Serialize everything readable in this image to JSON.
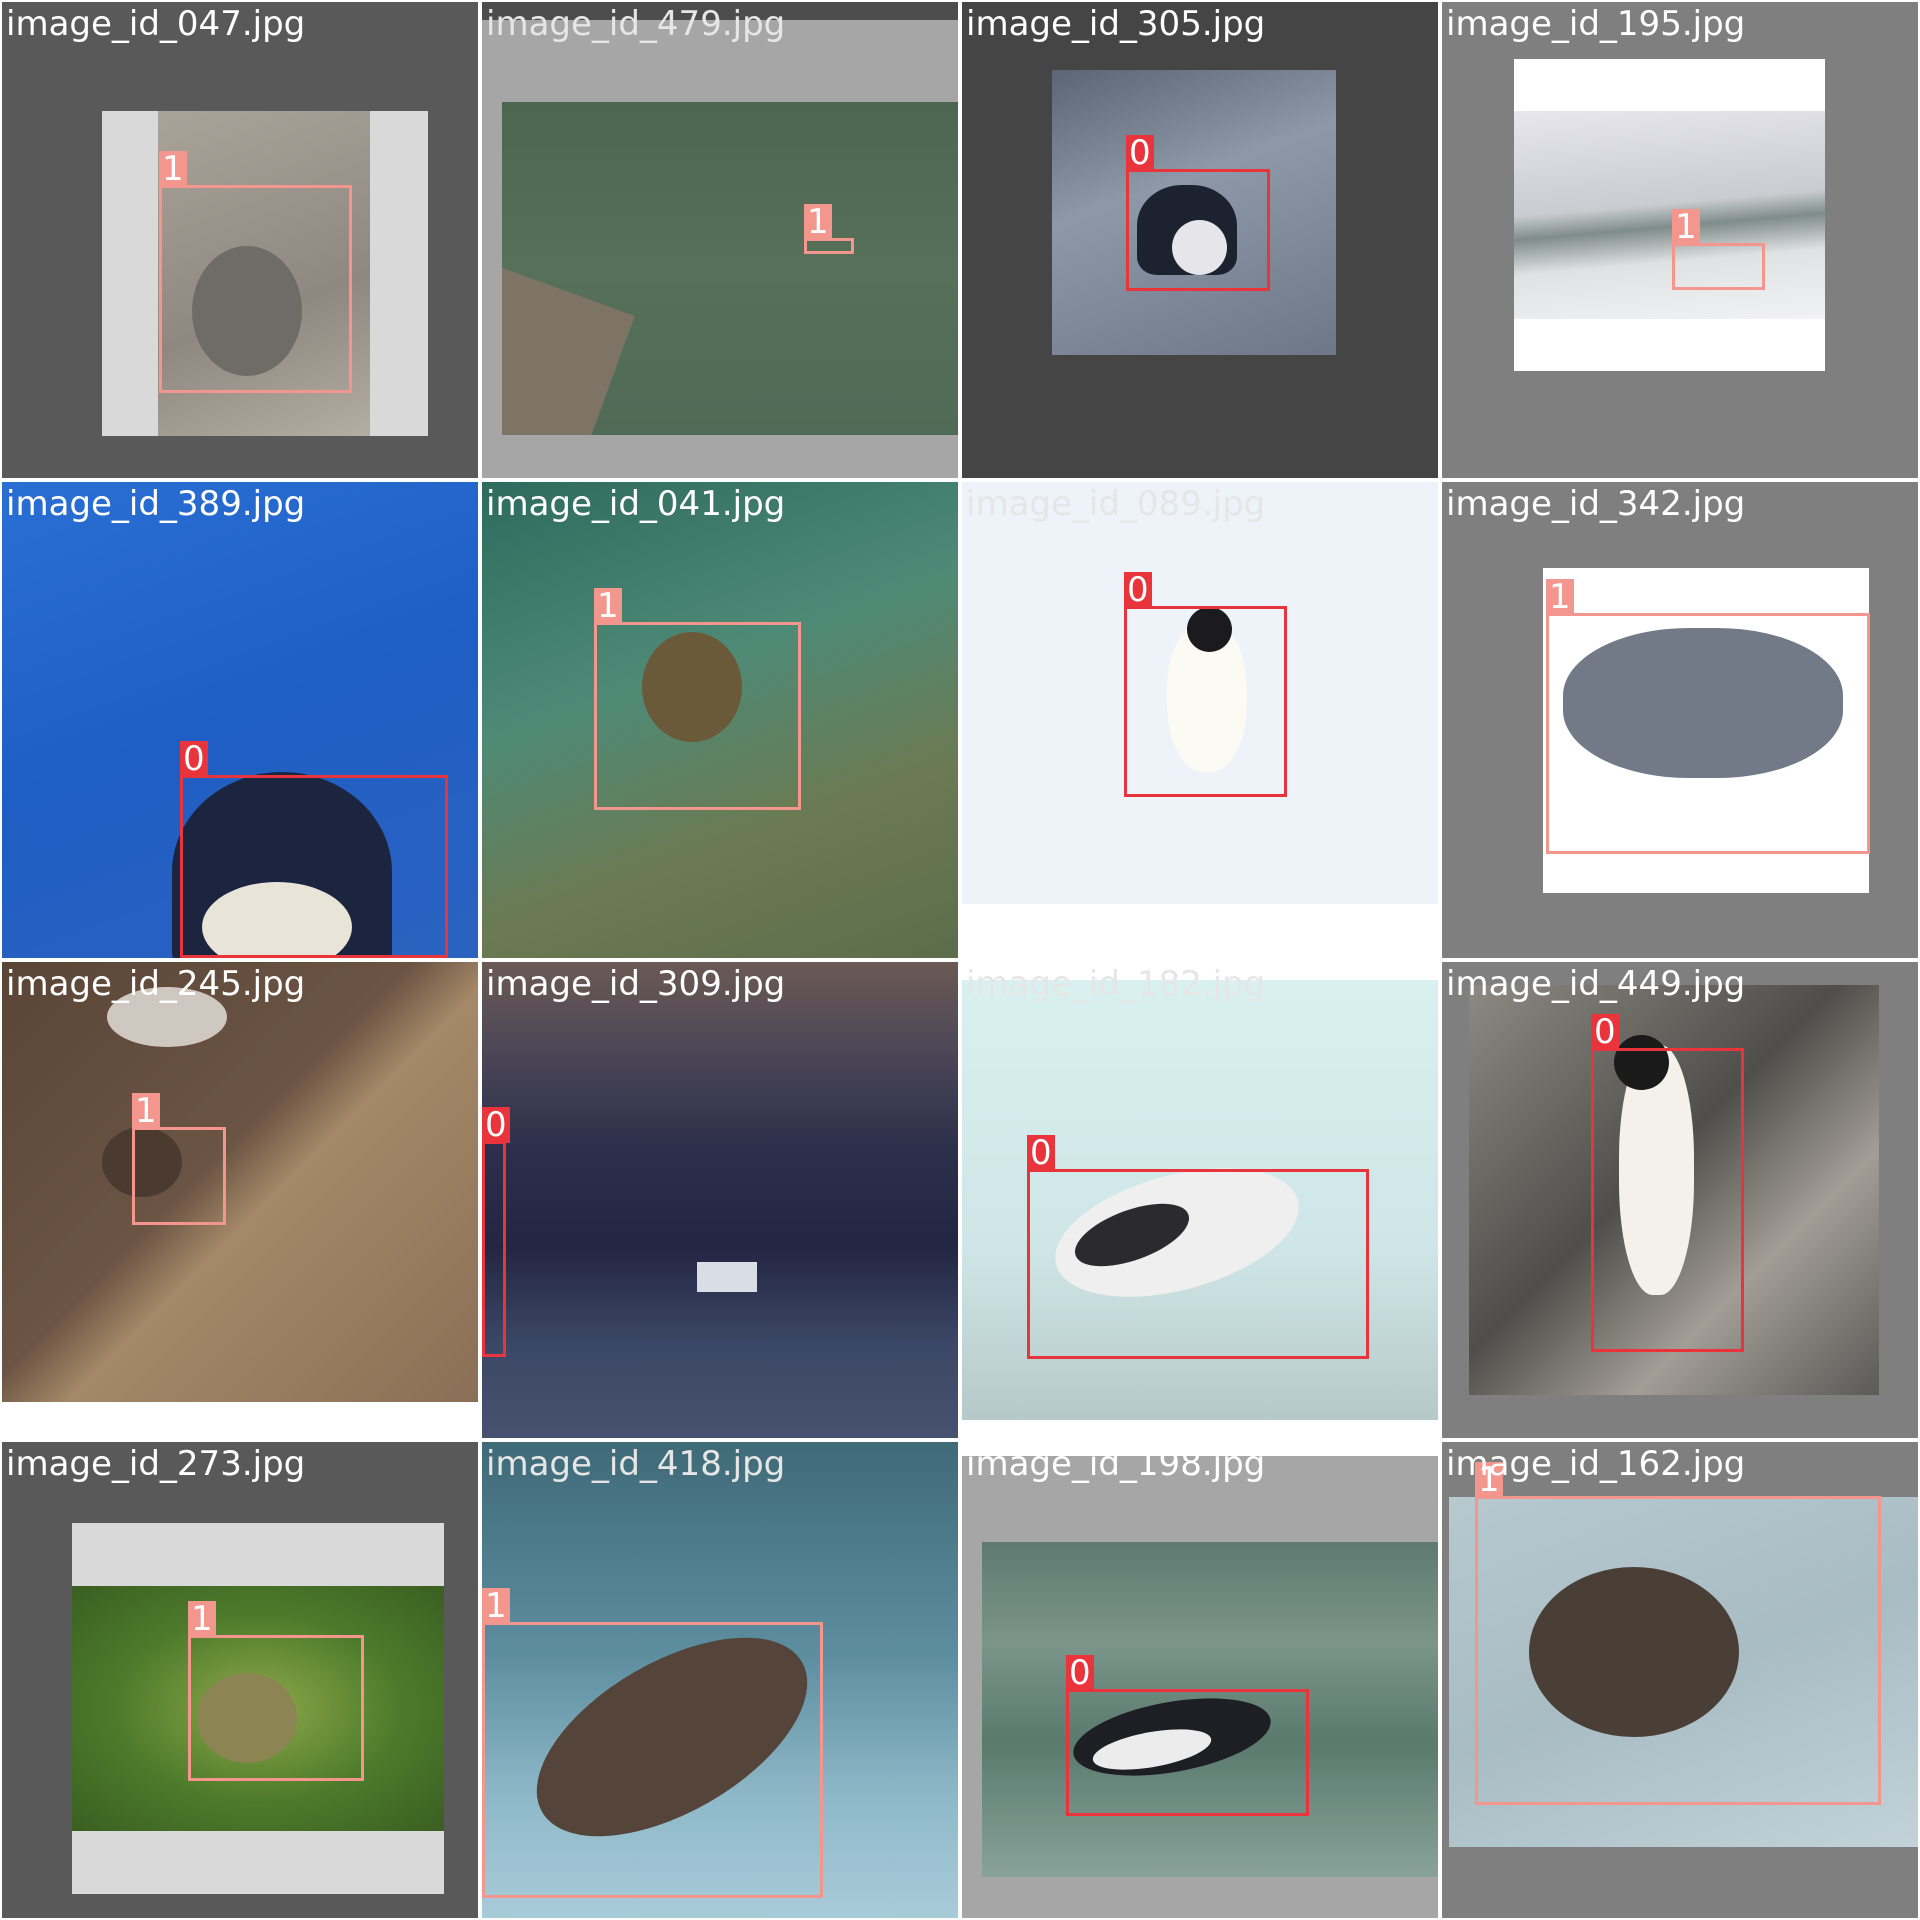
{
  "class_colors": {
    "0": "#e8343a",
    "1": "#f2968e"
  },
  "tiles": [
    {
      "filename": "image_id_047.jpg",
      "boxes": [
        {
          "class_label": "1"
        }
      ]
    },
    {
      "filename": "image_id_479.jpg",
      "boxes": [
        {
          "class_label": "1"
        }
      ]
    },
    {
      "filename": "image_id_305.jpg",
      "boxes": [
        {
          "class_label": "0"
        }
      ]
    },
    {
      "filename": "image_id_195.jpg",
      "boxes": [
        {
          "class_label": "1"
        }
      ]
    },
    {
      "filename": "image_id_389.jpg",
      "boxes": [
        {
          "class_label": "0"
        }
      ]
    },
    {
      "filename": "image_id_041.jpg",
      "boxes": [
        {
          "class_label": "1"
        }
      ]
    },
    {
      "filename": "image_id_089.jpg",
      "boxes": [
        {
          "class_label": "0"
        }
      ]
    },
    {
      "filename": "image_id_342.jpg",
      "boxes": [
        {
          "class_label": "1"
        }
      ]
    },
    {
      "filename": "image_id_245.jpg",
      "boxes": [
        {
          "class_label": "1"
        }
      ]
    },
    {
      "filename": "image_id_309.jpg",
      "boxes": [
        {
          "class_label": "0"
        }
      ]
    },
    {
      "filename": "image_id_182.jpg",
      "boxes": [
        {
          "class_label": "0"
        }
      ]
    },
    {
      "filename": "image_id_449.jpg",
      "boxes": [
        {
          "class_label": "0"
        }
      ]
    },
    {
      "filename": "image_id_273.jpg",
      "boxes": [
        {
          "class_label": "1"
        }
      ]
    },
    {
      "filename": "image_id_418.jpg",
      "boxes": [
        {
          "class_label": "1"
        }
      ]
    },
    {
      "filename": "image_id_198.jpg",
      "boxes": [
        {
          "class_label": "0"
        }
      ]
    },
    {
      "filename": "image_id_162.jpg",
      "boxes": [
        {
          "class_label": "1"
        }
      ]
    }
  ]
}
